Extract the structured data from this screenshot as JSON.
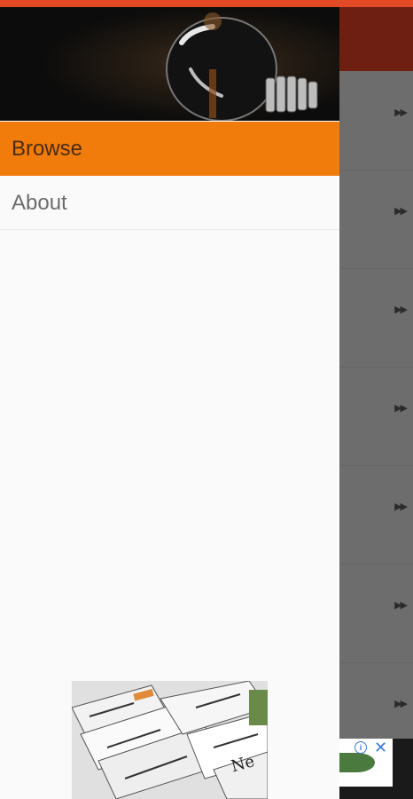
{
  "drawer": {
    "items": [
      {
        "label": "Browse",
        "active": true
      },
      {
        "label": "About",
        "active": false
      }
    ]
  },
  "background_list": {
    "arrow_icon": "double-play-icon",
    "rows": 7
  },
  "ad": {
    "info_icon": "info-icon",
    "close_icon": "close-icon"
  },
  "colors": {
    "status_bar": "#e24a26",
    "accent": "#f27c0b",
    "toolbar": "#6e1f12",
    "drawer_bg": "#fafafa"
  }
}
